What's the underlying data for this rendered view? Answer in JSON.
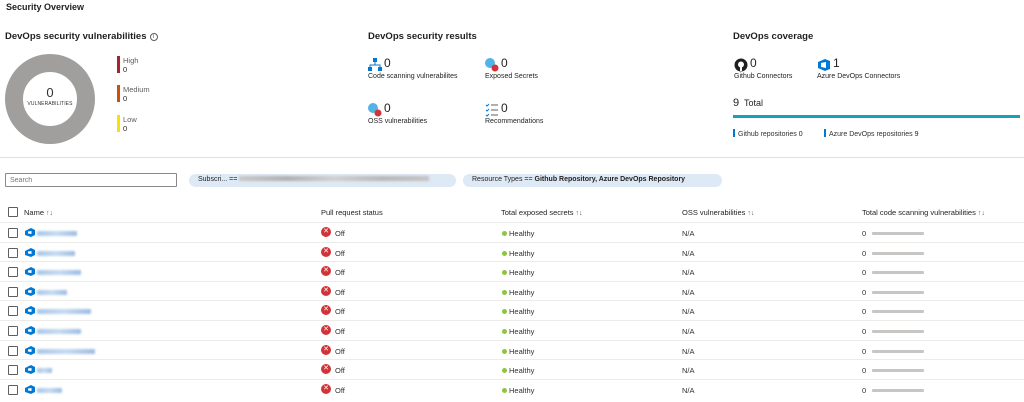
{
  "page": {
    "title": "Security Overview"
  },
  "vulnerabilities": {
    "title": "DevOps security vulnerabilities",
    "info_glyph": "i",
    "total": "0",
    "total_label": "VULNERABILITIES",
    "severities": [
      {
        "name": "High",
        "value": "0",
        "color": "#a4262c"
      },
      {
        "name": "Medium",
        "value": "0",
        "color": "#ca5010"
      },
      {
        "name": "Low",
        "value": "0",
        "color": "#fce100"
      }
    ]
  },
  "results": {
    "title": "DevOps security results",
    "metrics": [
      {
        "label": "Code scanning vulnerabilites",
        "value": "0",
        "icon": "code-scanning-icon"
      },
      {
        "label": "Exposed Secrets",
        "value": "0",
        "icon": "exposed-secrets-icon"
      },
      {
        "label": "OSS vulnerabilities",
        "value": "0",
        "icon": "oss-vulnerabilities-icon"
      },
      {
        "label": "Recommendations",
        "value": "0",
        "icon": "recommendations-icon"
      }
    ]
  },
  "coverage": {
    "title": "DevOps coverage",
    "connectors": [
      {
        "label": "Github Connectors",
        "value": "0",
        "icon": "github-icon"
      },
      {
        "label": "Azure DevOps Connectors",
        "value": "1",
        "icon": "azure-devops-icon"
      }
    ],
    "total_value": "9",
    "total_label": "Total",
    "legend": [
      {
        "label": "Github repositories",
        "value": "0"
      },
      {
        "label": "Azure DevOps repositories",
        "value": "9"
      }
    ]
  },
  "filters": {
    "search_placeholder": "Search",
    "subscription_label": "Subscri...",
    "subscription_op": "==",
    "resource_types_label": "Resource Types",
    "resource_types_op": "==",
    "resource_types_value": "Github Repository, Azure DevOps Repository"
  },
  "table": {
    "columns": {
      "name": "Name",
      "pr_status": "Pull request status",
      "secrets": "Total exposed secrets",
      "oss": "OSS vulnerabilities",
      "code": "Total code scanning vulnerabilities"
    },
    "sort_glyph": "↑↓",
    "rows": [
      {
        "pr": "Off",
        "secrets": "Healthy",
        "oss": "N/A",
        "code": "0"
      },
      {
        "pr": "Off",
        "secrets": "Healthy",
        "oss": "N/A",
        "code": "0"
      },
      {
        "pr": "Off",
        "secrets": "Healthy",
        "oss": "N/A",
        "code": "0"
      },
      {
        "pr": "Off",
        "secrets": "Healthy",
        "oss": "N/A",
        "code": "0"
      },
      {
        "pr": "Off",
        "secrets": "Healthy",
        "oss": "N/A",
        "code": "0"
      },
      {
        "pr": "Off",
        "secrets": "Healthy",
        "oss": "N/A",
        "code": "0"
      },
      {
        "pr": "Off",
        "secrets": "Healthy",
        "oss": "N/A",
        "code": "0"
      },
      {
        "pr": "Off",
        "secrets": "Healthy",
        "oss": "N/A",
        "code": "0"
      },
      {
        "pr": "Off",
        "secrets": "Healthy",
        "oss": "N/A",
        "code": "0"
      }
    ]
  }
}
